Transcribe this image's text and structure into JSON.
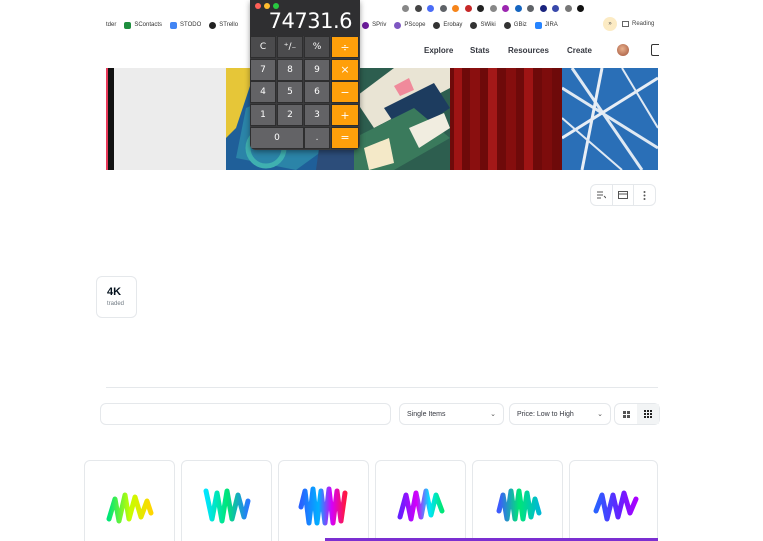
{
  "bookmarks": [
    {
      "label": "tder",
      "color": "#ffffff"
    },
    {
      "label": "SContacts",
      "color": "#1e8e3e"
    },
    {
      "label": "STODO",
      "color": "#4285f4"
    },
    {
      "label": "STrello",
      "color": "#222222"
    }
  ],
  "bookmarks_right": [
    {
      "label": "SPriv",
      "color": "#6a1b9a"
    },
    {
      "label": "PScope",
      "color": "#7e57c2"
    },
    {
      "label": "Erobay",
      "color": "#333333"
    },
    {
      "label": "SWiki",
      "color": "#333333"
    },
    {
      "label": "GBiz",
      "color": "#333333"
    },
    {
      "label": "JIRA",
      "color": "#2684ff"
    }
  ],
  "reading_list": "Reading",
  "nav": {
    "explore": "Explore",
    "stats": "Stats",
    "resources": "Resources",
    "create": "Create"
  },
  "calculator": {
    "display": "74731.6",
    "keys": [
      {
        "label": "C",
        "kind": "fn"
      },
      {
        "label": "⁺∕₋",
        "kind": "fn"
      },
      {
        "label": "%",
        "kind": "fn"
      },
      {
        "label": "÷",
        "kind": "op"
      },
      {
        "label": "7",
        "kind": "num"
      },
      {
        "label": "8",
        "kind": "num"
      },
      {
        "label": "9",
        "kind": "num"
      },
      {
        "label": "×",
        "kind": "op"
      },
      {
        "label": "4",
        "kind": "num"
      },
      {
        "label": "5",
        "kind": "num"
      },
      {
        "label": "6",
        "kind": "num"
      },
      {
        "label": "−",
        "kind": "op"
      },
      {
        "label": "1",
        "kind": "num"
      },
      {
        "label": "2",
        "kind": "num"
      },
      {
        "label": "3",
        "kind": "num"
      },
      {
        "label": "+",
        "kind": "op"
      },
      {
        "label": "0",
        "kind": "zero"
      },
      {
        "label": ".",
        "kind": "num"
      },
      {
        "label": "=",
        "kind": "op"
      }
    ]
  },
  "stat": {
    "value": "4K",
    "label": "traded"
  },
  "filters": {
    "item_type": "Single Items",
    "sort": "Price: Low to High"
  },
  "icons": {
    "list_icon": "list-icon",
    "table_icon": "table-icon",
    "more_icon": "more-vertical-icon",
    "grid_large_icon": "grid-large-icon",
    "grid_small_icon": "grid-small-icon"
  },
  "colors": {
    "calc_orange": "#ff9f0a",
    "accent_purple": "#7b2fd1",
    "border": "#e5e8eb"
  }
}
